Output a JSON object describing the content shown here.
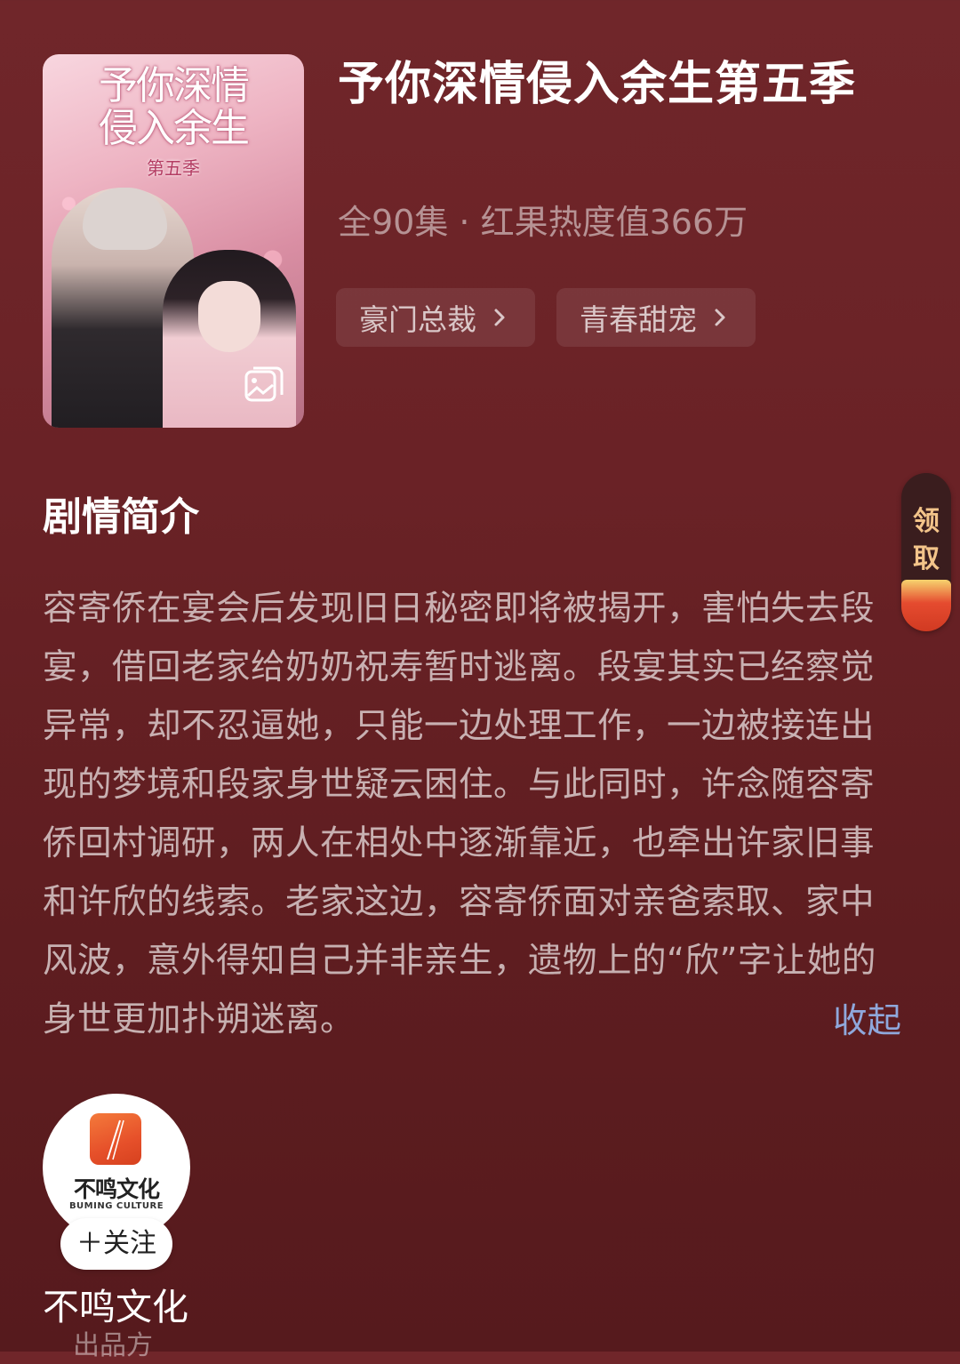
{
  "drama": {
    "cover_title_line1": "予你深情",
    "cover_title_line2": "侵入余生",
    "cover_subtitle": "第五季",
    "cover_icon": "gallery-icon",
    "title": "予你深情侵入余生第五季",
    "meta": "全90集 · 红果热度值366万",
    "tags": [
      {
        "label": "豪门总裁",
        "icon": "chevron-right-icon"
      },
      {
        "label": "青春甜宠",
        "icon": "chevron-right-icon"
      }
    ]
  },
  "synopsis": {
    "heading": "剧情简介",
    "text": "容寄侨在宴会后发现旧日秘密即将被揭开，害怕失去段宴，借回老家给奶奶祝寿暂时逃离。段宴其实已经察觉异常，却不忍逼她，只能一边处理工作，一边被接连出现的梦境和段家身世疑云困住。与此同时，许念随容寄侨回村调研，两人在相处中逐渐靠近，也牵出许家旧事和许欣的线索。老家这边，容寄侨面对亲爸索取、家中风波，意外得知自己并非亲生，遗物上的“欣”字让她的身世更加扑朔迷离。",
    "collapse_label": "收起"
  },
  "reward": {
    "label": "领取"
  },
  "publisher": {
    "logo_name": "不鸣文化",
    "logo_en": "BUMING CULTURE",
    "follow_label": "＋关注",
    "name": "不鸣文化",
    "role": "出品方"
  },
  "colors": {
    "background": "#6a2226",
    "link": "#8fa8dc",
    "reward_text": "#f3c48a"
  }
}
